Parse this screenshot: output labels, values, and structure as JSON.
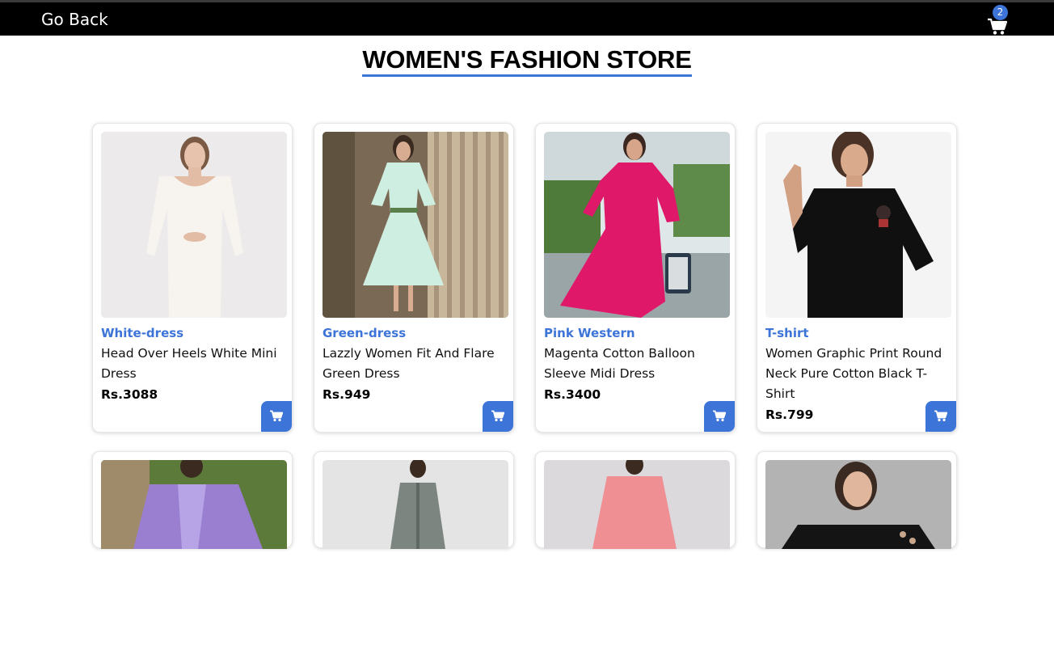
{
  "header": {
    "go_back": "Go Back",
    "cart_count": "2"
  },
  "title": "WOMEN'S FASHION STORE",
  "colors": {
    "accent": "#3d74d8",
    "topbar": "#000000"
  },
  "products": [
    {
      "category": "White-dress",
      "name": "Head Over Heels White Mini Dress",
      "price": "Rs.3088"
    },
    {
      "category": "Green-dress",
      "name": "Lazzly Women Fit And Flare Green Dress",
      "price": "Rs.949"
    },
    {
      "category": "Pink Western",
      "name": "Magenta Cotton Balloon Sleeve Midi Dress",
      "price": "Rs.3400"
    },
    {
      "category": "T-shirt",
      "name": "Women Graphic Print Round Neck Pure Cotton Black T-Shirt",
      "price": "Rs.799"
    }
  ],
  "icons": {
    "cart": "cart-icon",
    "add_to_cart": "add-to-cart-icon"
  }
}
